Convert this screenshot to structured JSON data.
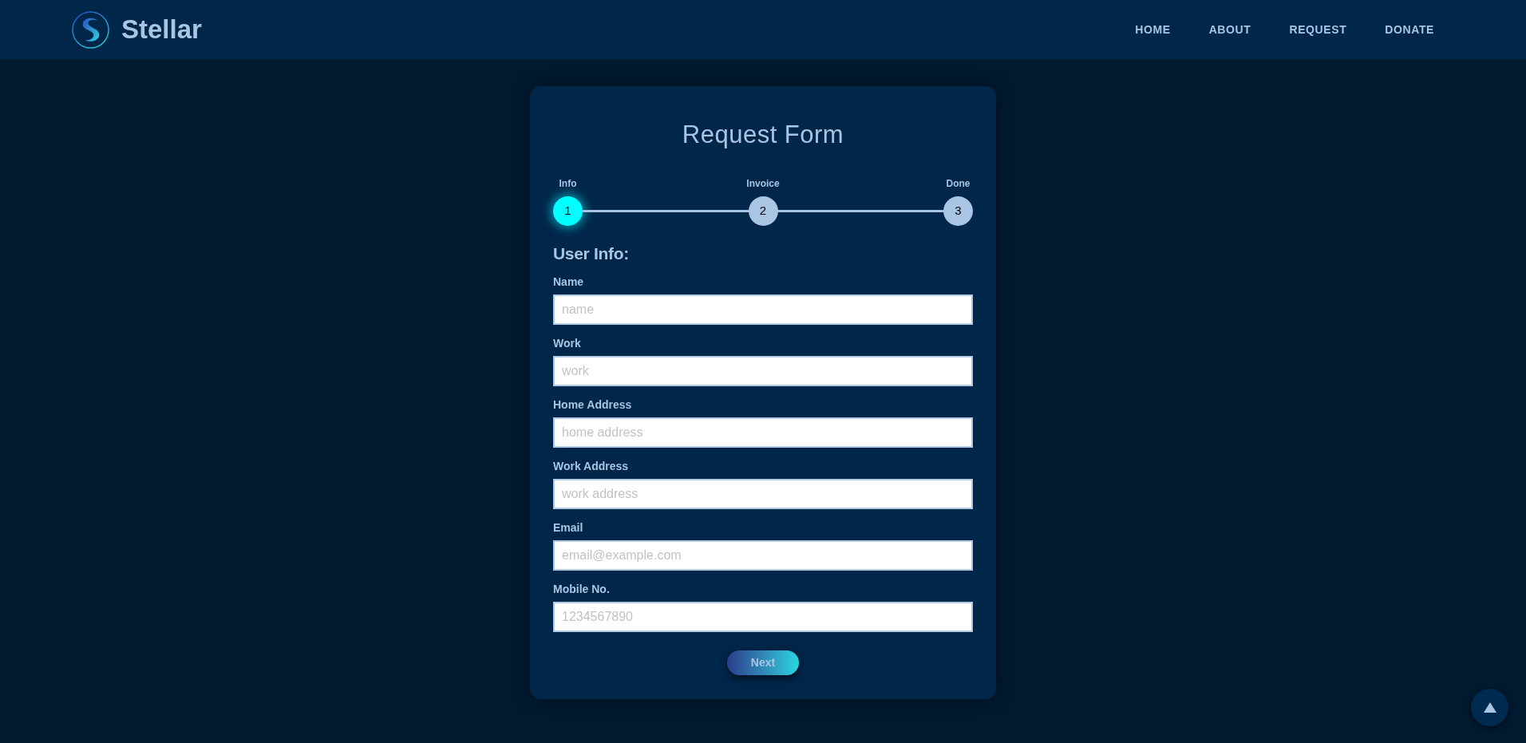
{
  "header": {
    "logo_text": "Stellar",
    "nav": [
      "HOME",
      "ABOUT",
      "REQUEST",
      "DONATE"
    ]
  },
  "form": {
    "title": "Request Form",
    "steps": [
      {
        "number": "1",
        "label": "Info",
        "selected": true
      },
      {
        "number": "2",
        "label": "Invoice",
        "selected": false
      },
      {
        "number": "3",
        "label": "Done",
        "selected": false
      }
    ],
    "section_title": "User Info:",
    "fields": [
      {
        "label": "Name",
        "placeholder": "name"
      },
      {
        "label": "Work",
        "placeholder": "work"
      },
      {
        "label": "Home Address",
        "placeholder": "home address"
      },
      {
        "label": "Work Address",
        "placeholder": "work address"
      },
      {
        "label": "Email",
        "placeholder": "email@example.com"
      },
      {
        "label": "Mobile No.",
        "placeholder": "1234567890"
      }
    ],
    "button": "Next"
  }
}
